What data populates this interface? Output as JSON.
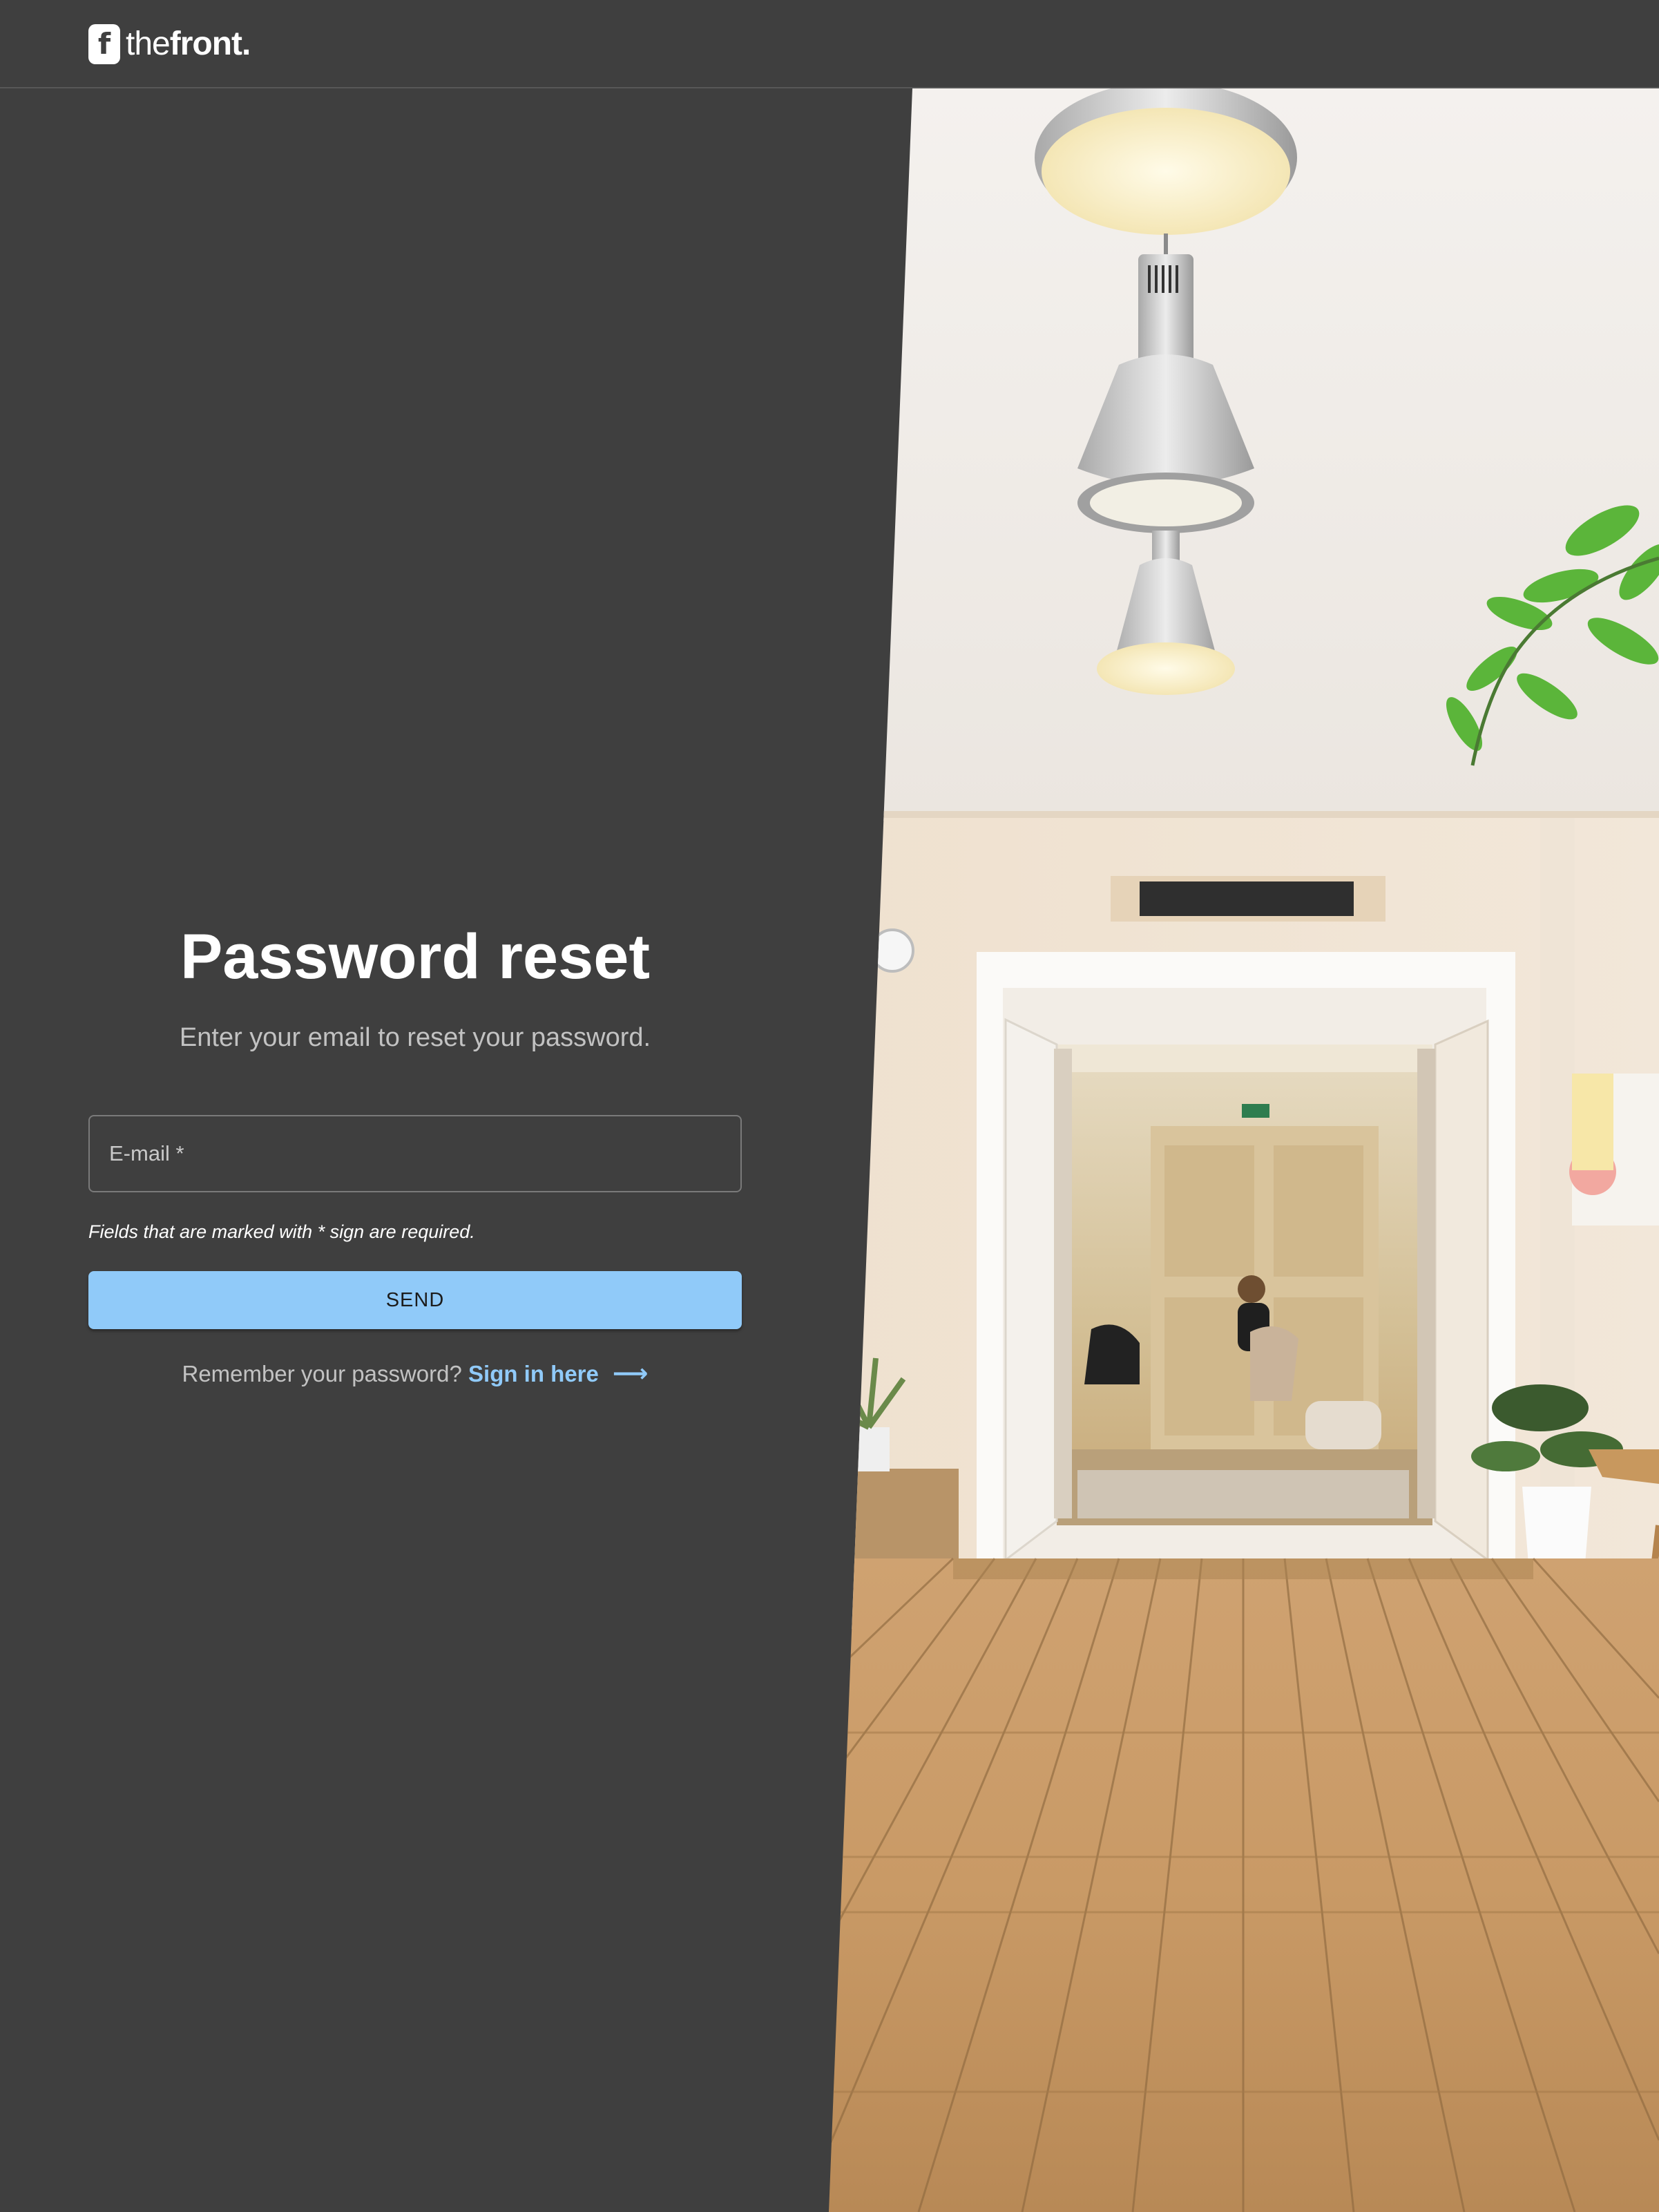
{
  "header": {
    "logo_mark": "f",
    "logo_light": "the",
    "logo_bold": "front."
  },
  "form": {
    "title": "Password reset",
    "subtitle": "Enter your email to reset your password.",
    "email_placeholder": "E-mail *",
    "email_value": "",
    "required_note": "Fields that are marked with * sign are required.",
    "send_label": "SEND",
    "remember_text": "Remember your password?",
    "signin_label": "Sign in here",
    "arrow_icon": "arrow-right-icon"
  },
  "colors": {
    "background": "#3f3f3f",
    "accent": "#90caf9",
    "text_primary": "#ffffff",
    "text_secondary": "#c2c2c2"
  }
}
